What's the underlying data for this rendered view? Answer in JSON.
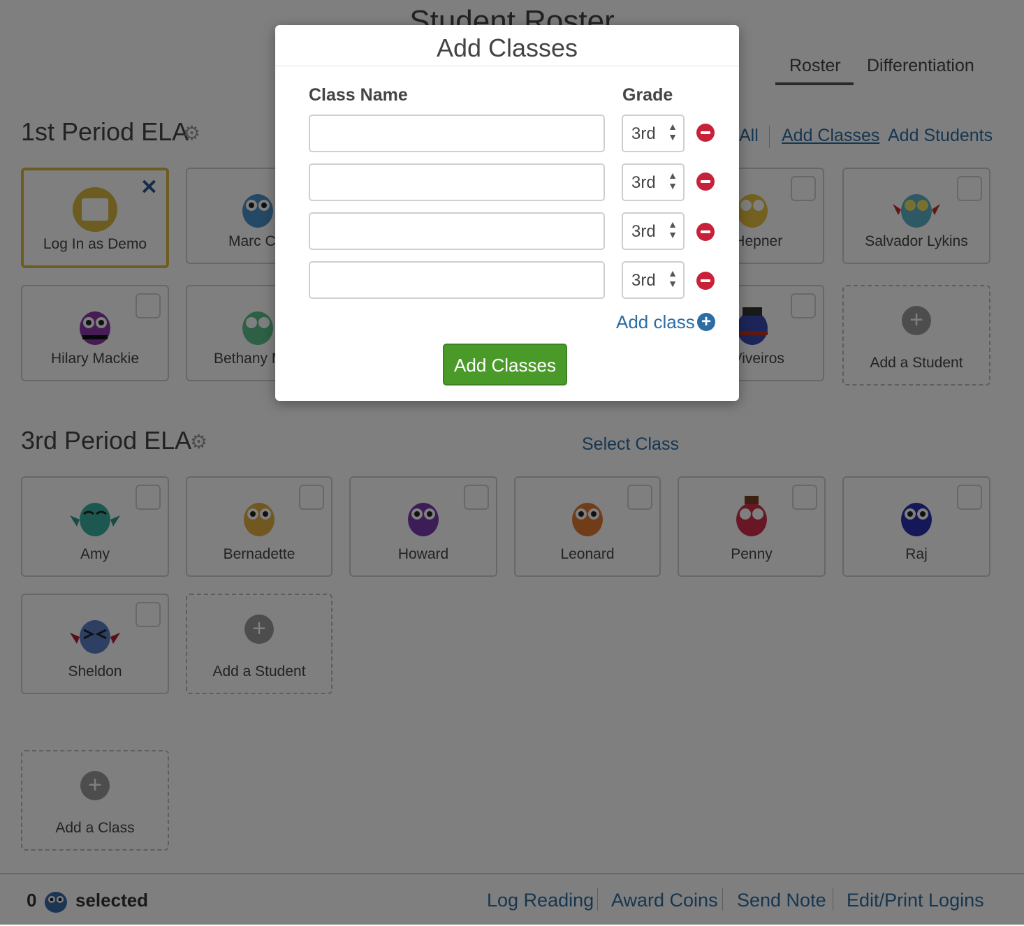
{
  "page": {
    "title": "Student Roster"
  },
  "tabs": [
    {
      "label": "Roster"
    },
    {
      "label": "Differentiation"
    }
  ],
  "class1": {
    "title": "1st Period ELA",
    "actions": {
      "all": "All",
      "add_classes": "Add Classes",
      "add_students": "Add Students"
    },
    "cards": [
      {
        "name": "Log In as Demo"
      },
      {
        "name": "Marc Clo"
      },
      {
        "name": "d Hepner"
      },
      {
        "name": "Salvador Lykins"
      },
      {
        "name": "Hilary Mackie"
      },
      {
        "name": "Bethany McC"
      },
      {
        "name": "n Viveiros"
      }
    ],
    "add_student": "Add a Student"
  },
  "class3": {
    "title": "3rd Period ELA",
    "select_class": "Select Class",
    "cards": [
      {
        "name": "Amy"
      },
      {
        "name": "Bernadette"
      },
      {
        "name": "Howard"
      },
      {
        "name": "Leonard"
      },
      {
        "name": "Penny"
      },
      {
        "name": "Raj"
      },
      {
        "name": "Sheldon"
      }
    ],
    "add_student": "Add a Student"
  },
  "add_class_card": "Add a Class",
  "footer": {
    "count": "0",
    "selected": "selected",
    "actions": [
      "Log Reading",
      "Award Coins",
      "Send Note",
      "Edit/Print Logins"
    ]
  },
  "modal": {
    "title": "Add Classes",
    "col_class_name": "Class Name",
    "col_grade": "Grade",
    "rows": [
      {
        "class_name": "",
        "grade": "3rd"
      },
      {
        "class_name": "",
        "grade": "3rd"
      },
      {
        "class_name": "",
        "grade": "3rd"
      },
      {
        "class_name": "",
        "grade": "3rd"
      }
    ],
    "add_class_link": "Add class",
    "submit": "Add Classes"
  },
  "colors": {
    "accent_link": "#2c6da3",
    "submit_green": "#4a9a2a",
    "remove_red": "#c8223a",
    "demo_gold": "#d8b840"
  },
  "icons": [
    "gear-icon",
    "close-icon",
    "owl-avatar-icon",
    "plus-circle-icon",
    "remove-circle-icon",
    "up-down-arrows-icon"
  ]
}
